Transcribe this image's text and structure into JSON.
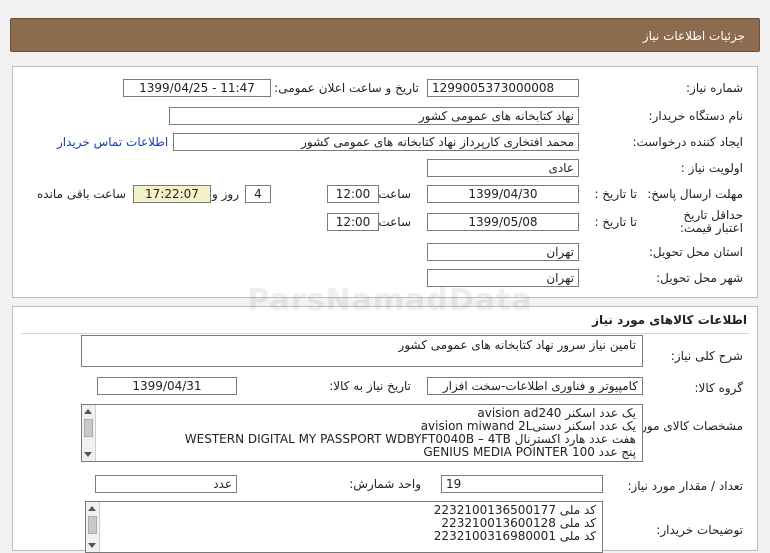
{
  "header": {
    "title": "جزئیات اطلاعات نیاز"
  },
  "watermark": {
    "text": "ParsNamadData"
  },
  "details": {
    "need_number_label": "شماره نیاز:",
    "need_number": "1299005373000008",
    "announce_label": "تاریخ و ساعت اعلان عمومی:",
    "announce_value": "1399/04/25 - 11:47",
    "buyer_org_label": "نام دستگاه خریدار:",
    "buyer_org": "نهاد کتابخانه های عمومی کشور",
    "requester_label": "ایجاد کننده درخواست:",
    "requester": "محمد افتخاری کارپرداز نهاد کتابخانه های عمومی کشور",
    "contact_link": "اطلاعات تماس خریدار",
    "priority_label": "اولویت نیاز :",
    "priority": "عادی",
    "deadline_label": "مهلت ارسال پاسخ:",
    "to_date_label": "تا تاریخ :",
    "deadline_date": "1399/04/30",
    "time_label": "ساعت",
    "deadline_time": "12:00",
    "days": "4",
    "days_label": "روز و",
    "remaining_time": "17:22:07",
    "remaining_label": "ساعت باقی مانده",
    "validity_label": "حداقل تاریخ اعتبار قیمت:",
    "validity_date": "1399/05/08",
    "validity_time": "12:00",
    "province_label": "استان محل تحویل:",
    "province": "تهران",
    "city_label": "شهر محل تحویل:",
    "city": "تهران"
  },
  "goods": {
    "section_title": "اطلاعات کالاهای مورد نیاز",
    "summary_label": "شرح کلی نیاز:",
    "summary": "تامین نیاز سرور نهاد کتابخانه های عمومی کشور",
    "group_label": "گروه کالا:",
    "group": "کامپیوتر و فناوری اطلاعات-سخت افزار",
    "need_date_label": "تاریخ نیاز به کالا:",
    "need_date": "1399/04/31",
    "specs_label": "مشخصات کالای مورد نیاز:",
    "specs": [
      "یک عدد اسکنر avision ad240",
      "یک عدد اسکنر دستیavision miwand 2L",
      "هفت عدد هارد اکسترنال WESTERN DIGITAL MY PASSPORT WDBYFT0040B – 4TB",
      "پنج عدد GENIUS MEDIA POINTER 100"
    ],
    "qty_label": "تعداد / مقدار مورد نیاز:",
    "qty": "19",
    "unit_label": "واحد شمارش:",
    "unit": "عدد",
    "notes_label": "توضیحات خریدار:",
    "notes": [
      "کد ملی 2232100136500177",
      "کد ملی 223210013600128",
      "کد ملی 2232100316980001"
    ]
  }
}
